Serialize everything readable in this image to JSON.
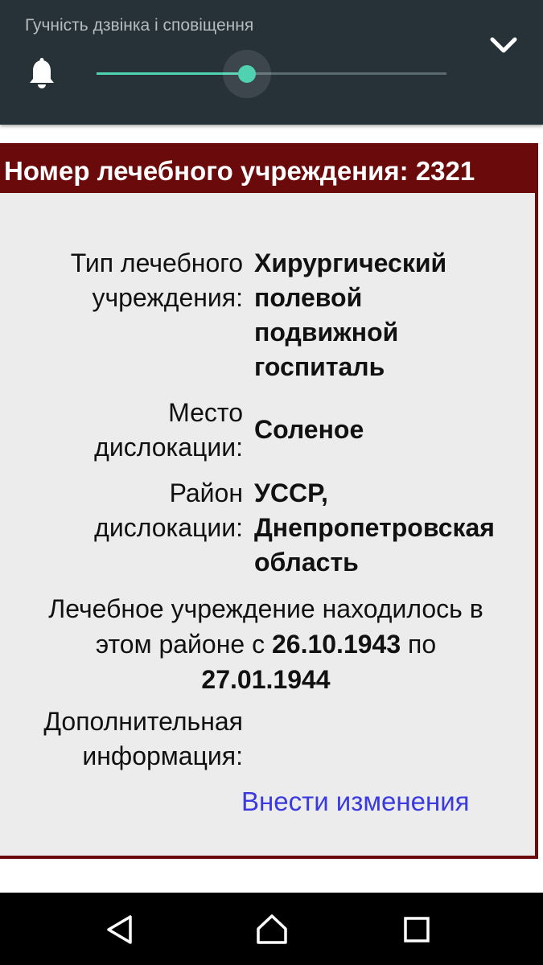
{
  "volume_panel": {
    "title": "Гучність дзвінка і сповіщення",
    "level_fraction": 0.43,
    "icons": [
      "bell-icon",
      "chevron-down-icon"
    ],
    "accent_color": "#4fd1b2"
  },
  "card": {
    "header": "Номер лечебного учреждения: 2321",
    "header_color": "#6a0a0a",
    "type": {
      "label_lines": [
        "Тип лечебного",
        "учреждения:"
      ],
      "value_lines": [
        "Хирургический",
        "полевой",
        "подвижной",
        "госпиталь"
      ]
    },
    "location": {
      "label_lines": [
        "Место",
        "дислокации:"
      ],
      "value": "Соленое"
    },
    "district": {
      "label_lines": [
        "Район",
        "дислокации:"
      ],
      "value_lines": [
        "УССР,",
        "Днепропетровская",
        "область"
      ]
    },
    "period": {
      "line1": "Лечебное учреждение находилось в",
      "line2_prefix": "этом районе с",
      "date_from": "26.10.1943",
      "line2_mid": "по",
      "date_to": "27.01.1944"
    },
    "additional": {
      "label_lines": [
        "Дополнительная",
        "информация:"
      ]
    },
    "edit_link": "Внести изменения",
    "link_color": "#3a3ae0"
  },
  "navbar": {
    "buttons": [
      "back-icon",
      "home-icon",
      "recents-icon"
    ]
  }
}
